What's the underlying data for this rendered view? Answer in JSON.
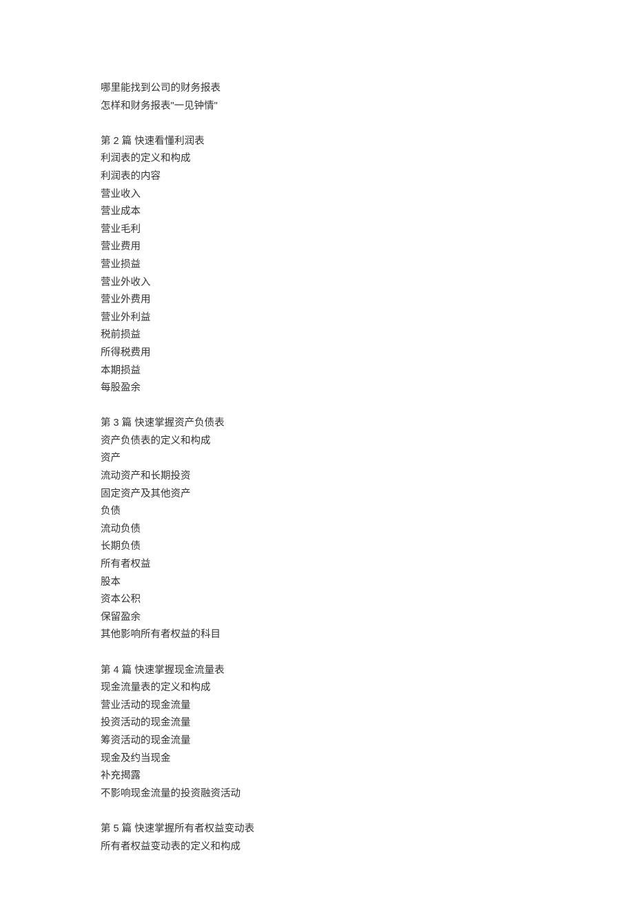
{
  "intro": [
    "哪里能找到公司的财务报表",
    "怎样和财务报表\"一见钟情\""
  ],
  "sections": [
    {
      "heading": "第 2 篇  快速看懂利润表",
      "items": [
        "利润表的定义和构成",
        "利润表的内容",
        "营业收入",
        "营业成本",
        "营业毛利",
        "营业费用",
        "营业损益",
        "营业外收入",
        "营业外费用",
        "营业外利益",
        "税前损益",
        "所得税费用",
        "本期损益",
        "每股盈余"
      ]
    },
    {
      "heading": "第 3 篇  快速掌握资产负债表",
      "items": [
        "资产负债表的定义和构成",
        "资产",
        "流动资产和长期投资",
        "固定资产及其他资产",
        "负债",
        "流动负债",
        "长期负债",
        "所有者权益",
        "股本",
        "资本公积",
        "保留盈余",
        "其他影响所有者权益的科目"
      ]
    },
    {
      "heading": "第 4 篇  快速掌握现金流量表",
      "items": [
        "现金流量表的定义和构成",
        "营业活动的现金流量",
        "投资活动的现金流量",
        "筹资活动的现金流量",
        "现金及约当现金",
        "补充揭露",
        "不影响现金流量的投资融资活动"
      ]
    },
    {
      "heading": "第 5 篇  快速掌握所有者权益变动表",
      "items": [
        "所有者权益变动表的定义和构成"
      ]
    }
  ]
}
